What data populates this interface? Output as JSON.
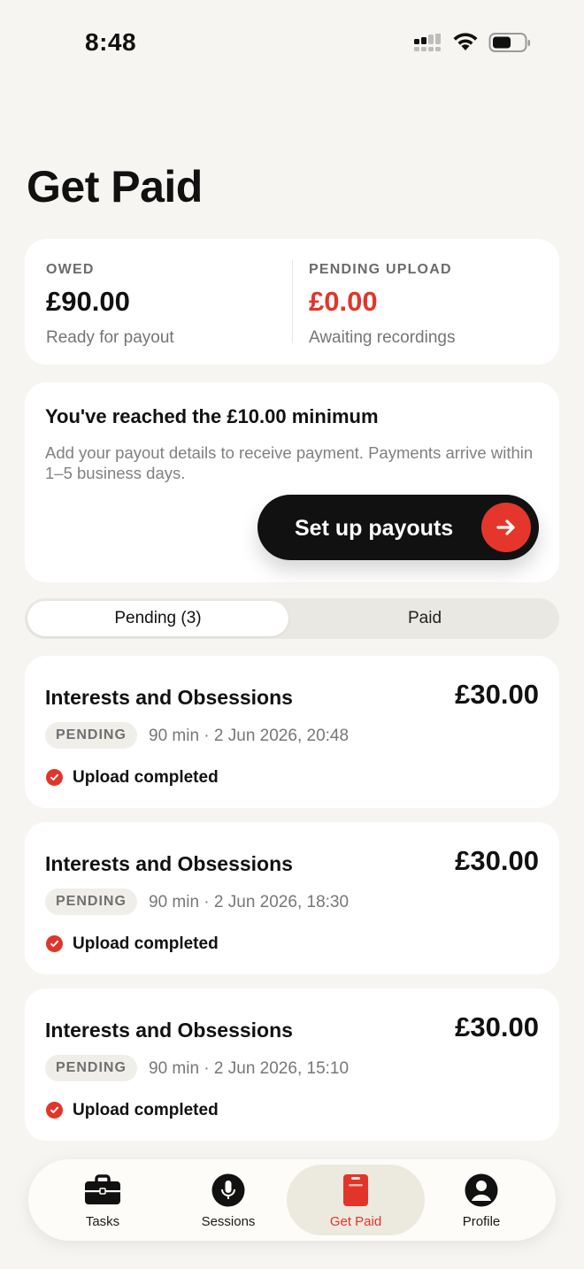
{
  "status_bar": {
    "time": "8:48"
  },
  "page": {
    "title": "Get Paid"
  },
  "balance": {
    "owed": {
      "label": "OWED",
      "amount": "£90.00",
      "sub": "Ready for payout"
    },
    "pending_upload": {
      "label": "PENDING UPLOAD",
      "amount": "£0.00",
      "sub": "Awaiting recordings",
      "amount_color": "#e2352a"
    }
  },
  "minimum_notice": {
    "title": "You've reached the £10.00 minimum",
    "description": "Add your payout details to receive payment. Payments arrive within 1–5 business days.",
    "button_label": "Set up payouts"
  },
  "tabs": [
    {
      "label": "Pending (3)",
      "active": true
    },
    {
      "label": "Paid",
      "active": false
    }
  ],
  "sessions": [
    {
      "title": "Interests and Obsessions",
      "amount": "£30.00",
      "badge": "PENDING",
      "meta": "90 min · 2 Jun 2026, 20:48",
      "status": "Upload completed"
    },
    {
      "title": "Interests and Obsessions",
      "amount": "£30.00",
      "badge": "PENDING",
      "meta": "90 min · 2 Jun 2026, 18:30",
      "status": "Upload completed"
    },
    {
      "title": "Interests and Obsessions",
      "amount": "£30.00",
      "badge": "PENDING",
      "meta": "90 min · 2 Jun 2026, 15:10",
      "status": "Upload completed"
    }
  ],
  "nav": [
    {
      "label": "Tasks",
      "icon": "briefcase-icon",
      "active": false
    },
    {
      "label": "Sessions",
      "icon": "microphone-icon",
      "active": false
    },
    {
      "label": "Get Paid",
      "icon": "receipt-icon",
      "active": true
    },
    {
      "label": "Profile",
      "icon": "person-icon",
      "active": false
    }
  ],
  "colors": {
    "accent": "#e2352a",
    "background": "#f6f5f1",
    "button": "#111111"
  }
}
